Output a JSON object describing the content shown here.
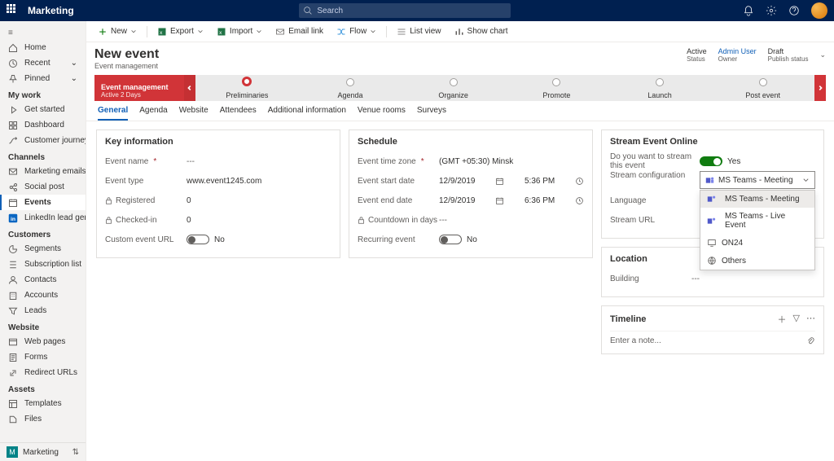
{
  "topbar": {
    "app": "Marketing",
    "searchPlaceholder": "Search"
  },
  "nav": {
    "home": "Home",
    "recent": "Recent",
    "pinned": "Pinned",
    "groups": {
      "mywork": "My work",
      "channels": "Channels",
      "customers": "Customers",
      "website": "Website",
      "assets": "Assets"
    },
    "items": {
      "getstarted": "Get started",
      "dashboard": "Dashboard",
      "journeys": "Customer journeys",
      "memails": "Marketing emails",
      "social": "Social post",
      "events": "Events",
      "linkedin": "LinkedIn lead gen",
      "segments": "Segments",
      "subs": "Subscription list",
      "contacts": "Contacts",
      "accounts": "Accounts",
      "leads": "Leads",
      "webpages": "Web pages",
      "forms": "Forms",
      "redirect": "Redirect URLs",
      "templates": "Templates",
      "files": "Files"
    },
    "footer": "Marketing"
  },
  "cmd": {
    "new": "New",
    "export": "Export",
    "import": "Import",
    "emaillink": "Email link",
    "flow": "Flow",
    "listview": "List view",
    "showchart": "Show chart"
  },
  "header": {
    "title": "New event",
    "subtitle": "Event management",
    "status1v": "Active",
    "status1k": "Status",
    "status2v": "Admin User",
    "status2k": "Owner",
    "status3v": "Draft",
    "status3k": "Publish status"
  },
  "process": {
    "stage1": "Event management",
    "stage1sub": "Active 2 Days",
    "s2": "Preliminaries",
    "s3": "Agenda",
    "s4": "Organize",
    "s5": "Promote",
    "s6": "Launch",
    "s7": "Post event"
  },
  "tabs": [
    "General",
    "Agenda",
    "Website",
    "Attendees",
    "Additional information",
    "Venue rooms",
    "Surveys"
  ],
  "key": {
    "title": "Key information",
    "name_l": "Event name",
    "name_v": "---",
    "type_l": "Event type",
    "type_v": "www.event1245.com",
    "reg_l": "Registered",
    "reg_v": "0",
    "chk_l": "Checked-in",
    "chk_v": "0",
    "url_l": "Custom event URL",
    "no": "No"
  },
  "sched": {
    "title": "Schedule",
    "tz_l": "Event time zone",
    "tz_v": "(GMT +05:30) Minsk",
    "start_l": "Event start date",
    "start_d": "12/9/2019",
    "start_t": "5:36 PM",
    "end_l": "Event end date",
    "end_d": "12/9/2019",
    "end_t": "6:36 PM",
    "cd_l": "Countdown in days",
    "cd_v": "---",
    "rec_l": "Recurring event",
    "no": "No"
  },
  "stream": {
    "title": "Stream Event Online",
    "q": "Do you want to stream this event",
    "yes": "Yes",
    "config_l": "Stream configuration",
    "selected": "MS Teams - Meeting",
    "opts": [
      "MS Teams - Meeting",
      "MS Teams - Live Event",
      "ON24",
      "Others"
    ],
    "lang_l": "Language",
    "lang_v": "",
    "url_l": "Stream URL",
    "url_v": ""
  },
  "loc": {
    "title": "Location",
    "bld_l": "Building",
    "bld_v": "---"
  },
  "tl": {
    "title": "Timeline",
    "note": "Enter a note..."
  }
}
